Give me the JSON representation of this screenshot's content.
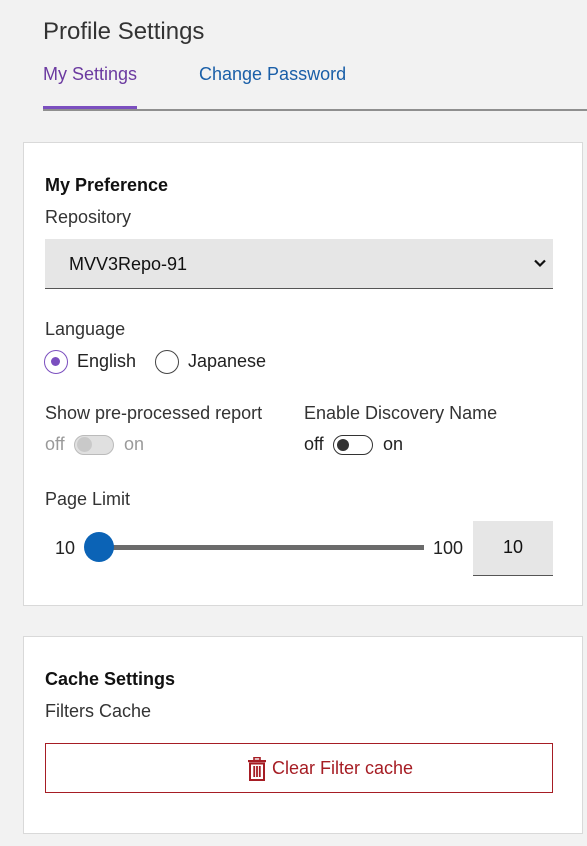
{
  "header": {
    "title": "Profile Settings"
  },
  "tabs": [
    {
      "label": "My Settings",
      "active": true
    },
    {
      "label": "Change Password",
      "active": false
    }
  ],
  "preference": {
    "title": "My Preference",
    "repository": {
      "label": "Repository",
      "selected": "MVV3Repo-91"
    },
    "language": {
      "label": "Language",
      "options": [
        {
          "label": "English",
          "checked": true
        },
        {
          "label": "Japanese",
          "checked": false
        }
      ]
    },
    "show_preprocessed": {
      "label": "Show pre-processed report",
      "off": "off",
      "on": "on",
      "enabled": false,
      "value": "off"
    },
    "enable_discovery": {
      "label": "Enable Discovery Name",
      "off": "off",
      "on": "on",
      "enabled": true,
      "value": "off"
    },
    "page_limit": {
      "label": "Page Limit",
      "min": "10",
      "max": "100",
      "value": "10"
    }
  },
  "cache": {
    "title": "Cache Settings",
    "filters_label": "Filters Cache",
    "clear_button": "Clear Filter cache"
  },
  "colors": {
    "accent": "#7b4fbf",
    "link": "#1a5fa8",
    "slider": "#0b63b6",
    "danger": "#a61d24"
  },
  "icons": {
    "select": "chevron-down-icon",
    "clear": "trash-icon"
  }
}
